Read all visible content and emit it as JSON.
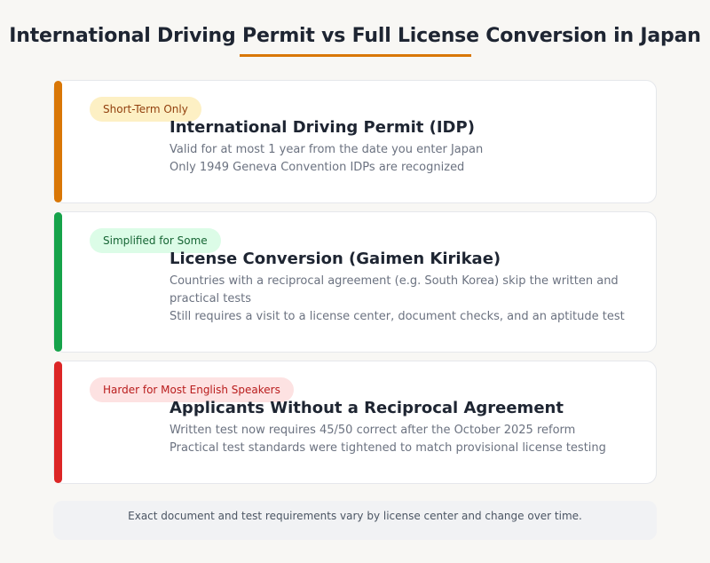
{
  "page": {
    "title": "International Driving Permit vs Full License Conversion in Japan",
    "accent_color": "#d97706"
  },
  "cards": [
    {
      "badge": "Short-Term Only",
      "title": "International Driving Permit (IDP)",
      "lines": [
        "Valid for at most 1 year from the date you enter Japan",
        "Only 1949 Geneva Convention IDPs are recognized"
      ],
      "status_color": "#d97706"
    },
    {
      "badge": "Simplified for Some",
      "title": "License Conversion (Gaimen Kirikae)",
      "lines": [
        "Countries with a reciprocal agreement (e.g. South Korea) skip the written and practical tests",
        "Still requires a visit to a license center, document checks, and an aptitude test"
      ],
      "status_color": "#16a34a"
    },
    {
      "badge": "Harder for Most English Speakers",
      "title": "Applicants Without a Reciprocal Agreement",
      "lines": [
        "Written test now requires 45/50 correct after the October 2025 reform",
        "Practical test standards were tightened to match provisional license testing"
      ],
      "status_color": "#dc2626"
    }
  ],
  "footer": {
    "note": "Exact document and test requirements vary by license center and change over time."
  }
}
